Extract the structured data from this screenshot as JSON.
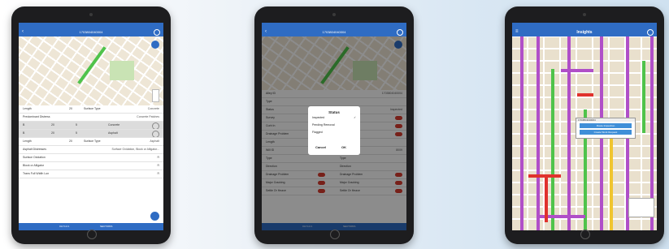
{
  "devices": [
    {
      "app_bar_title": "1703804040004",
      "panel_rows": [
        {
          "label": "Length",
          "value": "20",
          "field": "Surface Type",
          "field_value": "Concrete"
        },
        {
          "label": "Predominant Distress",
          "value": "",
          "field": "",
          "field_value": "Concrete Patches"
        },
        {
          "label": "B",
          "value": "20",
          "field": "5",
          "field_value": "Concrete"
        },
        {
          "label": "B",
          "value": "20",
          "field": "5",
          "field_value": "Asphalt"
        },
        {
          "label": "Length",
          "value": "20",
          "field": "Surface Type",
          "field_value": "Asphalt"
        },
        {
          "label": "Asphalt Distresses",
          "value": "",
          "field": "",
          "field_value": "Surface Oxidation, Block or Alligator..."
        },
        {
          "label": "Surface Oxidation",
          "value": "",
          "field": "",
          "field_value": "R"
        },
        {
          "label": "Block or Alligator",
          "value": "",
          "field": "",
          "field_value": "R"
        },
        {
          "label": "Trans Full Width Lon",
          "value": "",
          "field": "",
          "field_value": "R"
        }
      ],
      "tabs": [
        "DETAILS",
        "SECTIONS"
      ]
    },
    {
      "app_bar_title": "1703804040004",
      "rows": [
        {
          "label": "Alley ID",
          "value": "1703804040004"
        },
        {
          "label": "Type",
          "value": ""
        },
        {
          "label": "Status",
          "value": "Inspected"
        },
        {
          "label": "Survey",
          "value": ""
        },
        {
          "label": "Curb In",
          "value": ""
        },
        {
          "label": "Drainage Problem",
          "value": ""
        },
        {
          "label": "Length",
          "value": ""
        },
        {
          "label": "Will ID",
          "value": "8009"
        },
        {
          "label": "Type",
          "value": "Type"
        },
        {
          "label": "Direction",
          "value": "Direction"
        },
        {
          "label": "Drainage Problem",
          "value": "Drainage Problem"
        },
        {
          "label": "Major Cracking",
          "value": "Major Cracking"
        },
        {
          "label": "Settle Or Heave",
          "value": "Settle Or Heave"
        }
      ],
      "dialog": {
        "title": "Status",
        "options": [
          "Inspected",
          "Pending Removal",
          "Flagged"
        ],
        "check_mark": "✓",
        "cancel_label": "Cancel",
        "ok_label": "OK"
      },
      "tabs": [
        "DETAILS",
        "SECTIONS"
      ]
    },
    {
      "app_bar_title": "Insights",
      "popup": {
        "header": "1703804040004",
        "btn_primary": "Route Inspection",
        "btn_secondary": "Create Work Request"
      }
    }
  ],
  "colors": {
    "app_blue": "#2f6cc3",
    "toggle_red": "#d93b2f",
    "line_green": "#4fc34b",
    "line_purple": "#b04fc8",
    "line_red": "#e0322d",
    "line_yellow": "#f0c52f"
  }
}
